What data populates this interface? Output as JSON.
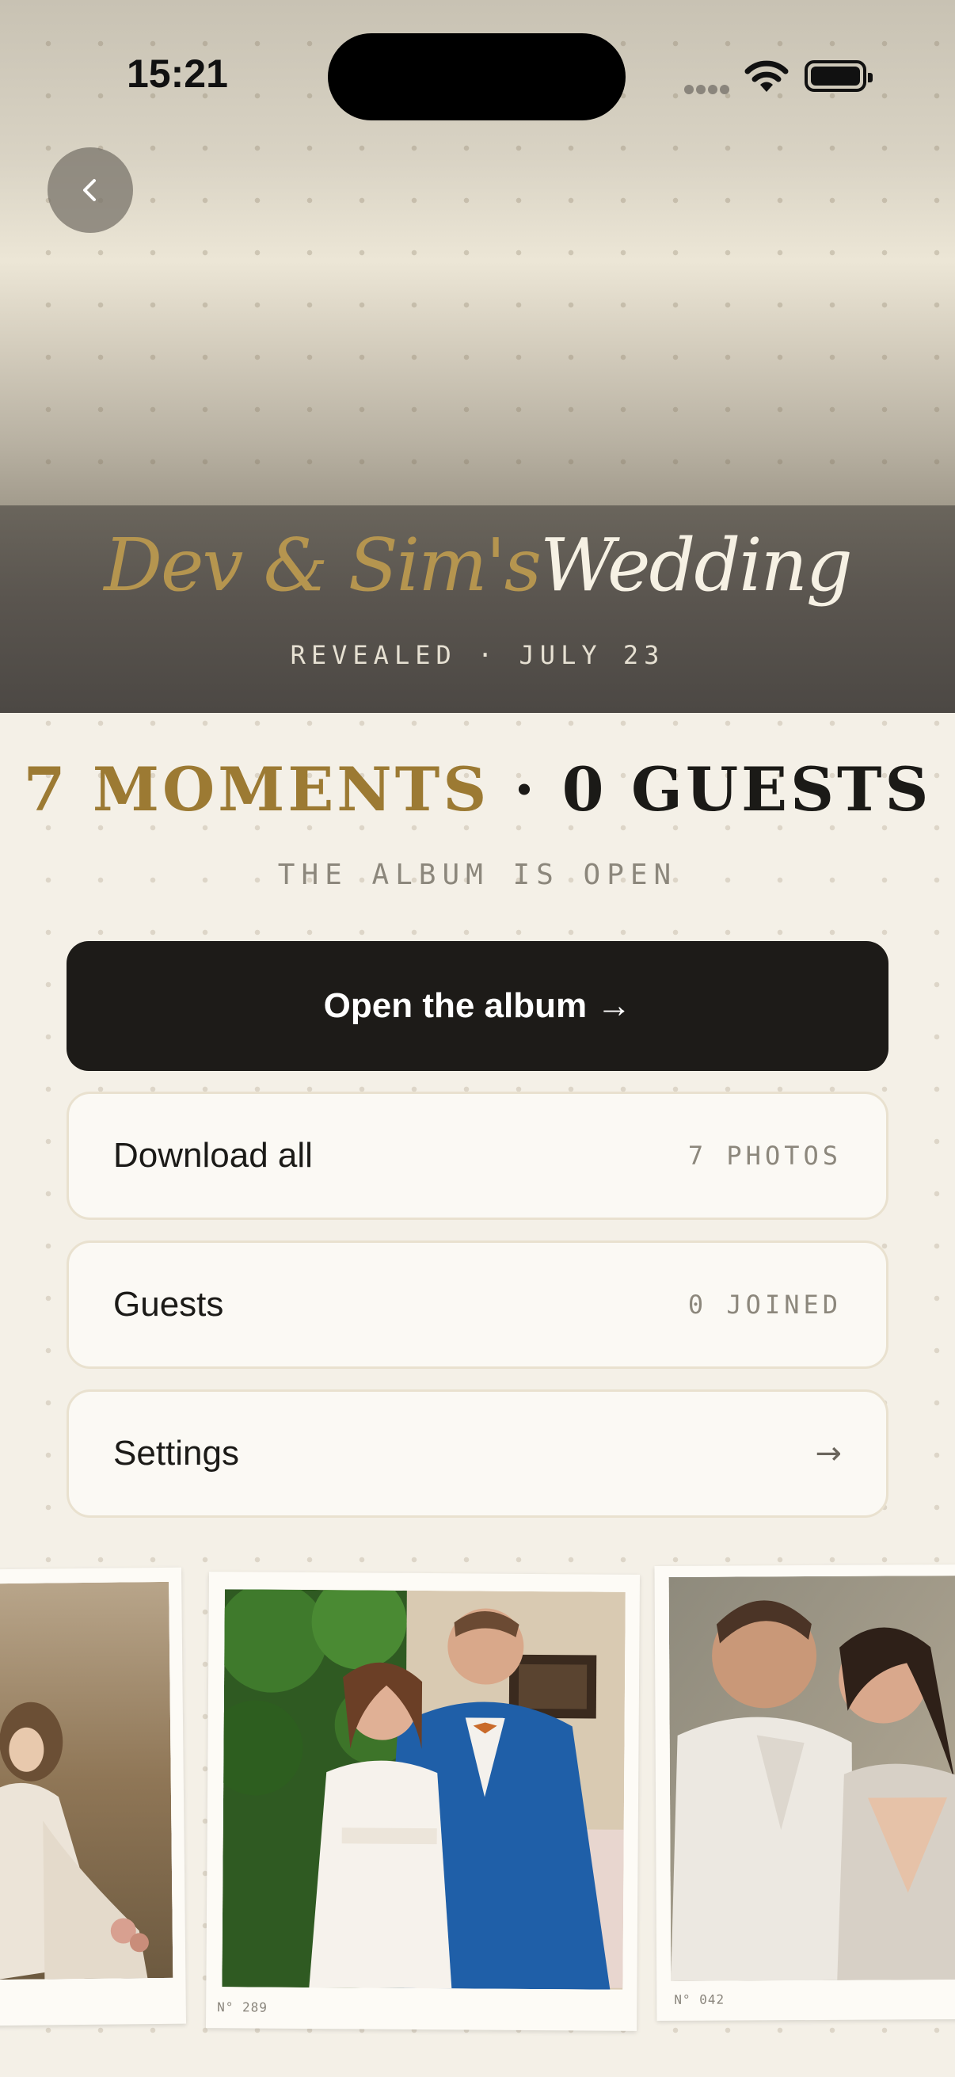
{
  "status_bar": {
    "time": "15:21"
  },
  "hero": {
    "title_part1": "Dev & Sim's",
    "title_part2": "Wedding",
    "subtitle": "REVEALED · JULY 23"
  },
  "summary": {
    "moments": "7 MOMENTS",
    "separator": "·",
    "guests": "0 GUESTS",
    "caption": "THE ALBUM IS OPEN"
  },
  "actions": {
    "open_album": "Open the album →",
    "download": {
      "label": "Download all",
      "meta": "7 PHOTOS"
    },
    "guests": {
      "label": "Guests",
      "meta": "0 JOINED"
    },
    "settings": {
      "label": "Settings",
      "arrow": "→"
    }
  },
  "photos": [
    {
      "number": ""
    },
    {
      "number": "N° 289"
    },
    {
      "number": "N° 042"
    }
  ],
  "colors": {
    "gold": "#9c7a33",
    "dark": "#1d1b18",
    "cream": "#f4f0e7"
  }
}
